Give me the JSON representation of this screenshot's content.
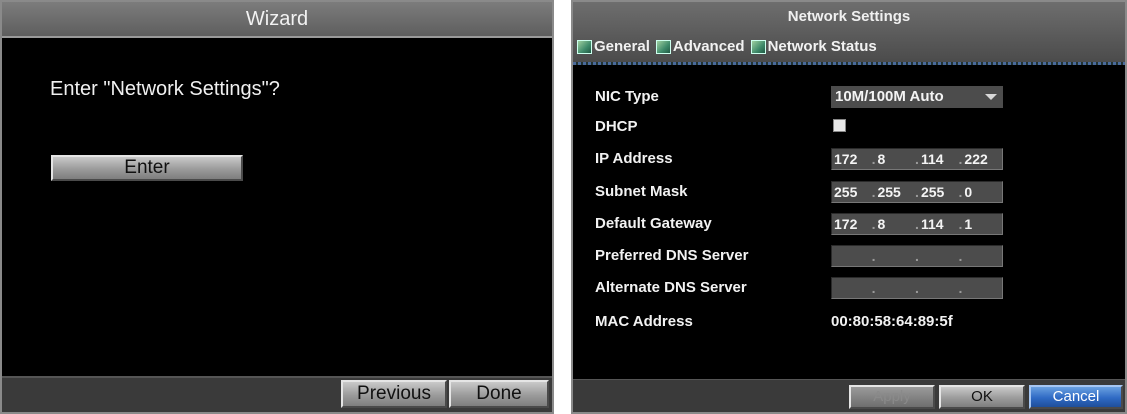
{
  "wizard": {
    "title": "Wizard",
    "question": "Enter \"Network Settings\"?",
    "enter_label": "Enter",
    "previous_label": "Previous",
    "done_label": "Done"
  },
  "network": {
    "title": "Network Settings",
    "tabs": [
      "General",
      "Advanced",
      "Network Status"
    ],
    "fields": {
      "nic_type": {
        "label": "NIC Type",
        "value": "10M/100M Auto"
      },
      "dhcp": {
        "label": "DHCP",
        "checked": false
      },
      "ip_address": {
        "label": "IP Address",
        "octets": [
          "172",
          "8",
          "114",
          "222"
        ]
      },
      "subnet_mask": {
        "label": "Subnet Mask",
        "octets": [
          "255",
          "255",
          "255",
          "0"
        ]
      },
      "default_gateway": {
        "label": "Default Gateway",
        "octets": [
          "172",
          "8",
          "114",
          "1"
        ]
      },
      "preferred_dns": {
        "label": "Preferred DNS Server",
        "octets": [
          "",
          "",
          "",
          ""
        ]
      },
      "alternate_dns": {
        "label": "Alternate DNS Server",
        "octets": [
          "",
          "",
          "",
          ""
        ]
      },
      "mac_address": {
        "label": "MAC Address",
        "value": "00:80:58:64:89:5f"
      }
    },
    "buttons": {
      "apply": "Apply",
      "ok": "OK",
      "cancel": "Cancel"
    }
  },
  "colors": {
    "panel_bg": "#000000",
    "cancel_accent": "#2f6ac4",
    "title_bar": "#5e5e5e"
  }
}
